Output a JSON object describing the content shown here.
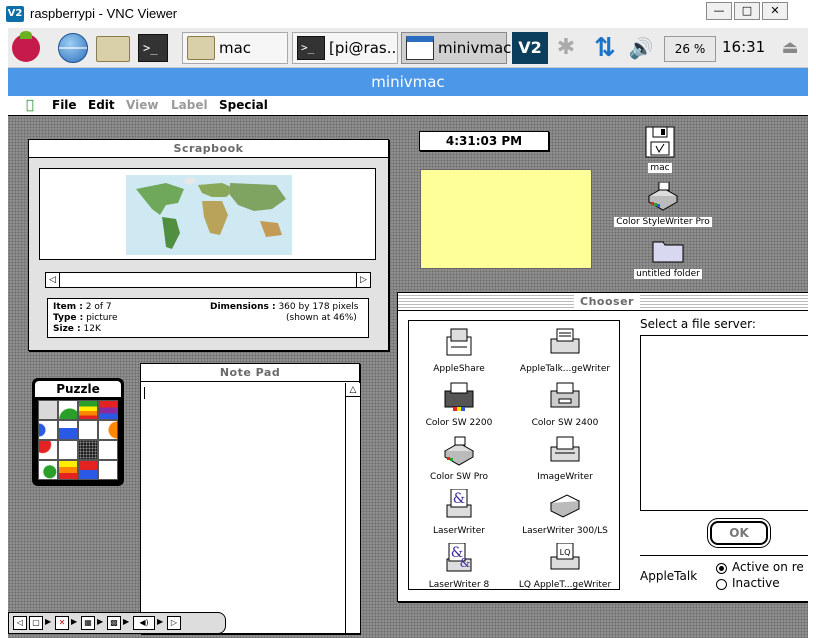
{
  "window": {
    "title": "raspberrypi - VNC Viewer",
    "logo_text": "V2",
    "minimize": "—",
    "maximize": "□",
    "close": "✕"
  },
  "taskbar": {
    "tasks": [
      {
        "label": "mac",
        "icon": "folder-icon"
      },
      {
        "label": "[pi@ras...",
        "icon": "terminal-icon"
      },
      {
        "label": "minivmac",
        "icon": "window-icon"
      }
    ],
    "term_glyph": ">_",
    "vnc_glyph": "V2",
    "bt_glyph": "✱",
    "net_glyph": "⇅",
    "vol_glyph": "🔊",
    "cpu": "26 %",
    "clock": "16:31",
    "eject_glyph": "⏏"
  },
  "minivmac": {
    "title": "minivmac",
    "menubar": {
      "apple": "",
      "items": [
        "File",
        "Edit",
        "View",
        "Label",
        "Special"
      ]
    },
    "scrapbook": {
      "title": "Scrapbook",
      "info": {
        "item_label": "Item :",
        "item_value": "2 of 7",
        "type_label": "Type :",
        "type_value": "picture",
        "size_label": "Size :",
        "size_value": "12K",
        "dims_label": "Dimensions :",
        "dims_value": "360 by 178 pixels",
        "shown": "(shown at 46%)"
      },
      "left_arrow": "◁",
      "right_arrow": "▷"
    },
    "puzzle": {
      "title": "Puzzle"
    },
    "notepad": {
      "title": "Note Pad",
      "up_arrow": "△"
    },
    "clock": "4:31:03 PM",
    "desktop_icons": [
      {
        "label": "mac"
      },
      {
        "label": "Color StyleWriter Pro"
      },
      {
        "label": "untitled folder"
      }
    ],
    "chooser": {
      "title": "Chooser",
      "items": [
        "AppleShare",
        "AppleTalk...geWriter",
        "Color SW 2200",
        "Color SW 2400",
        "Color SW Pro",
        "ImageWriter",
        "LaserWriter",
        "LaserWriter 300/LS",
        "LaserWriter 8",
        "LQ AppleT...geWriter"
      ],
      "select_label": "Select a file server:",
      "ok_label": "OK",
      "appletalk_label": "AppleTalk",
      "active_label": "Active on re",
      "inactive_label": "Inactive"
    },
    "control_strip": [
      "◁",
      "▢",
      "▶",
      "✕",
      "▶",
      "▦",
      "▶",
      "▩",
      "▶",
      "◀)",
      "▶",
      "▷"
    ]
  }
}
